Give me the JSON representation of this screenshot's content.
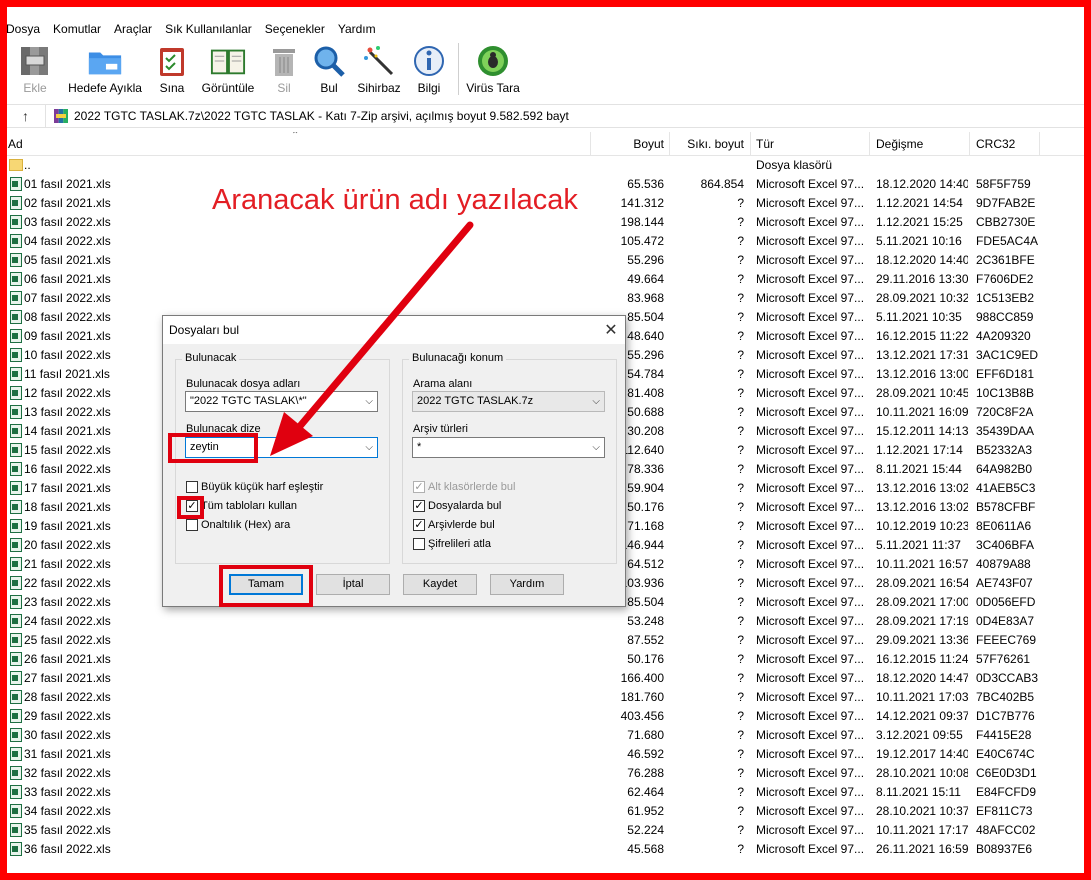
{
  "menu": [
    "Dosya",
    "Komutlar",
    "Araçlar",
    "Sık Kullanılanlar",
    "Seçenekler",
    "Yardım"
  ],
  "toolbar": [
    {
      "label": "Ekle",
      "icon": "archive-add-icon",
      "disabled": true
    },
    {
      "label": "Hedefe Ayıkla",
      "icon": "extract-folder-icon",
      "disabled": false
    },
    {
      "label": "Sına",
      "icon": "test-clipboard-icon",
      "disabled": false
    },
    {
      "label": "Görüntüle",
      "icon": "view-book-icon",
      "disabled": false
    },
    {
      "label": "Sil",
      "icon": "trash-icon",
      "disabled": true
    },
    {
      "label": "Bul",
      "icon": "find-magnifier-icon",
      "disabled": false
    },
    {
      "label": "Sihirbaz",
      "icon": "wizard-wand-icon",
      "disabled": false
    },
    {
      "label": "Bilgi",
      "icon": "info-icon",
      "disabled": false
    },
    {
      "label": "Virüs Tara",
      "icon": "virus-scan-icon",
      "disabled": false
    }
  ],
  "address": {
    "path": "2022 TGTC TASLAK.7z\\2022 TGTC TASLAK - Katı 7-Zip arşivi, açılmış boyut 9.582.592 bayt"
  },
  "columns": {
    "name": "Ad",
    "size": "Boyut",
    "packed": "Sıkı. boyut",
    "type": "Tür",
    "modified": "Değişme",
    "crc": "CRC32"
  },
  "rows": [
    {
      "name": "..",
      "size": "",
      "packed": "",
      "type": "Dosya klasörü",
      "modified": "",
      "crc": "",
      "folder": true
    },
    {
      "name": "01 fasıl 2021.xls",
      "size": "65.536",
      "packed": "864.854",
      "type": "Microsoft Excel 97...",
      "modified": "18.12.2020 14:40",
      "crc": "58F5F759"
    },
    {
      "name": "02 fasıl 2021.xls",
      "size": "141.312",
      "packed": "?",
      "type": "Microsoft Excel 97...",
      "modified": "1.12.2021 14:54",
      "crc": "9D7FAB2E"
    },
    {
      "name": "03 fasıl 2022.xls",
      "size": "198.144",
      "packed": "?",
      "type": "Microsoft Excel 97...",
      "modified": "1.12.2021 15:25",
      "crc": "CBB2730E"
    },
    {
      "name": "04 fasıl 2022.xls",
      "size": "105.472",
      "packed": "?",
      "type": "Microsoft Excel 97...",
      "modified": "5.11.2021 10:16",
      "crc": "FDE5AC4A"
    },
    {
      "name": "05 fasıl 2021.xls",
      "size": "55.296",
      "packed": "?",
      "type": "Microsoft Excel 97...",
      "modified": "18.12.2020 14:40",
      "crc": "2C361BFE"
    },
    {
      "name": "06 fasıl 2021.xls",
      "size": "49.664",
      "packed": "?",
      "type": "Microsoft Excel 97...",
      "modified": "29.11.2016 13:30",
      "crc": "F7606DE2"
    },
    {
      "name": "07 fasıl 2022.xls",
      "size": "83.968",
      "packed": "?",
      "type": "Microsoft Excel 97...",
      "modified": "28.09.2021 10:32",
      "crc": "1C513EB2"
    },
    {
      "name": "08 fasıl 2022.xls",
      "size": "85.504",
      "packed": "?",
      "type": "Microsoft Excel 97...",
      "modified": "5.11.2021 10:35",
      "crc": "988CC859"
    },
    {
      "name": "09 fasıl 2021.xls",
      "size": "48.640",
      "packed": "?",
      "type": "Microsoft Excel 97...",
      "modified": "16.12.2015 11:22",
      "crc": "4A209320"
    },
    {
      "name": "10 fasıl 2022.xls",
      "size": "55.296",
      "packed": "?",
      "type": "Microsoft Excel 97...",
      "modified": "13.12.2021 17:31",
      "crc": "3AC1C9ED"
    },
    {
      "name": "11 fasıl 2021.xls",
      "size": "54.784",
      "packed": "?",
      "type": "Microsoft Excel 97...",
      "modified": "13.12.2016 13:00",
      "crc": "EFF6D181"
    },
    {
      "name": "12 fasıl 2022.xls",
      "size": "81.408",
      "packed": "?",
      "type": "Microsoft Excel 97...",
      "modified": "28.09.2021 10:45",
      "crc": "10C13B8B"
    },
    {
      "name": "13 fasıl 2022.xls",
      "size": "50.688",
      "packed": "?",
      "type": "Microsoft Excel 97...",
      "modified": "10.11.2021 16:09",
      "crc": "720C8F2A"
    },
    {
      "name": "14 fasıl 2021.xls",
      "size": "30.208",
      "packed": "?",
      "type": "Microsoft Excel 97...",
      "modified": "15.12.2011 14:13",
      "crc": "35439DAA"
    },
    {
      "name": "15 fasıl 2022.xls",
      "size": "112.640",
      "packed": "?",
      "type": "Microsoft Excel 97...",
      "modified": "1.12.2021 17:14",
      "crc": "B52332A3"
    },
    {
      "name": "16 fasıl 2022.xls",
      "size": "78.336",
      "packed": "?",
      "type": "Microsoft Excel 97...",
      "modified": "8.11.2021 15:44",
      "crc": "64A982B0"
    },
    {
      "name": "17 fasıl 2021.xls",
      "size": "59.904",
      "packed": "?",
      "type": "Microsoft Excel 97...",
      "modified": "13.12.2016 13:02",
      "crc": "41AEB5C3"
    },
    {
      "name": "18 fasıl 2021.xls",
      "size": "50.176",
      "packed": "?",
      "type": "Microsoft Excel 97...",
      "modified": "13.12.2016 13:02",
      "crc": "B578CFBF"
    },
    {
      "name": "19 fasıl 2021.xls",
      "size": "71.168",
      "packed": "?",
      "type": "Microsoft Excel 97...",
      "modified": "10.12.2019 10:23",
      "crc": "8E0611A6"
    },
    {
      "name": "20 fasıl 2022.xls",
      "size": "146.944",
      "packed": "?",
      "type": "Microsoft Excel 97...",
      "modified": "5.11.2021 11:37",
      "crc": "3C406BFA"
    },
    {
      "name": "21 fasıl 2022.xls",
      "size": "64.512",
      "packed": "?",
      "type": "Microsoft Excel 97...",
      "modified": "10.11.2021 16:57",
      "crc": "40879A88"
    },
    {
      "name": "22 fasıl 2022.xls",
      "size": "103.936",
      "packed": "?",
      "type": "Microsoft Excel 97...",
      "modified": "28.09.2021 16:54",
      "crc": "AE743F07"
    },
    {
      "name": "23 fasıl 2022.xls",
      "size": "85.504",
      "packed": "?",
      "type": "Microsoft Excel 97...",
      "modified": "28.09.2021 17:00",
      "crc": "0D056EFD"
    },
    {
      "name": "24 fasıl 2022.xls",
      "size": "53.248",
      "packed": "?",
      "type": "Microsoft Excel 97...",
      "modified": "28.09.2021 17:19",
      "crc": "0D4E83A7"
    },
    {
      "name": "25 fasıl 2022.xls",
      "size": "87.552",
      "packed": "?",
      "type": "Microsoft Excel 97...",
      "modified": "29.09.2021 13:36",
      "crc": "FEEEC769"
    },
    {
      "name": "26 fasıl 2021.xls",
      "size": "50.176",
      "packed": "?",
      "type": "Microsoft Excel 97...",
      "modified": "16.12.2015 11:24",
      "crc": "57F76261"
    },
    {
      "name": "27 fasıl 2021.xls",
      "size": "166.400",
      "packed": "?",
      "type": "Microsoft Excel 97...",
      "modified": "18.12.2020 14:47",
      "crc": "0D3CCAB3"
    },
    {
      "name": "28 fasıl 2022.xls",
      "size": "181.760",
      "packed": "?",
      "type": "Microsoft Excel 97...",
      "modified": "10.11.2021 17:03",
      "crc": "7BC402B5"
    },
    {
      "name": "29 fasıl 2022.xls",
      "size": "403.456",
      "packed": "?",
      "type": "Microsoft Excel 97...",
      "modified": "14.12.2021 09:37",
      "crc": "D1C7B776"
    },
    {
      "name": "30 fasıl 2022.xls",
      "size": "71.680",
      "packed": "?",
      "type": "Microsoft Excel 97...",
      "modified": "3.12.2021 09:55",
      "crc": "F4415E28"
    },
    {
      "name": "31 fasıl 2021.xls",
      "size": "46.592",
      "packed": "?",
      "type": "Microsoft Excel 97...",
      "modified": "19.12.2017 14:40",
      "crc": "E40C674C"
    },
    {
      "name": "32 fasıl 2022.xls",
      "size": "76.288",
      "packed": "?",
      "type": "Microsoft Excel 97...",
      "modified": "28.10.2021 10:08",
      "crc": "C6E0D3D1"
    },
    {
      "name": "33 fasıl 2022.xls",
      "size": "62.464",
      "packed": "?",
      "type": "Microsoft Excel 97...",
      "modified": "8.11.2021 15:11",
      "crc": "E84FCFD9"
    },
    {
      "name": "34 fasıl 2022.xls",
      "size": "61.952",
      "packed": "?",
      "type": "Microsoft Excel 97...",
      "modified": "28.10.2021 10:37",
      "crc": "EF811C73"
    },
    {
      "name": "35 fasıl 2022.xls",
      "size": "52.224",
      "packed": "?",
      "type": "Microsoft Excel 97...",
      "modified": "10.11.2021 17:17",
      "crc": "48AFCC02"
    },
    {
      "name": "36 fasıl 2022.xls",
      "size": "45.568",
      "packed": "?",
      "type": "Microsoft Excel 97...",
      "modified": "26.11.2021 16:59",
      "crc": "B08937E6"
    }
  ],
  "dialog": {
    "title": "Dosyaları bul",
    "left_group": "Bulunacak",
    "file_names_label": "Bulunacak dosya adları",
    "file_names_value": "\"2022 TGTC TASLAK\\*\"",
    "string_label": "Bulunacak dize",
    "string_value": "zeytin",
    "match_case": "Büyük küçük harf eşleştir",
    "use_all_tables": "Tüm tabloları kullan",
    "hex_search": "Onaltılık (Hex) ara",
    "right_group": "Bulunacağı konum",
    "search_area_label": "Arama alanı",
    "search_area_value": "2022 TGTC TASLAK.7z",
    "archive_types_label": "Arşiv türleri",
    "archive_types_value": "*",
    "subfolders": "Alt klasörlerde bul",
    "in_files": "Dosyalarda bul",
    "in_archives": "Arşivlerde bul",
    "skip_encrypted": "Şifrelileri atla",
    "ok": "Tamam",
    "cancel": "İptal",
    "save": "Kaydet",
    "help": "Yardım"
  },
  "annotation": {
    "text": "Aranacak ürün adı yazılacak",
    "color": "#e31e24"
  }
}
